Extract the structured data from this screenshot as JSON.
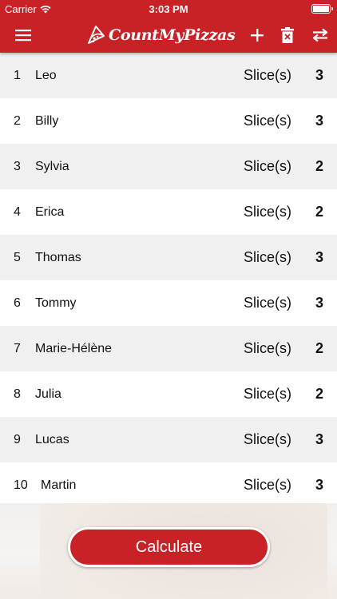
{
  "status_bar": {
    "carrier": "Carrier",
    "time": "3:03 PM"
  },
  "nav_bar": {
    "logo_text": "CountMyPizzas",
    "icons": [
      "menu-icon",
      "pizza-slice-icon",
      "add-icon",
      "delete-icon",
      "swap-icon"
    ]
  },
  "list": {
    "rows": [
      {
        "index": "1",
        "name": "Leo",
        "unit": "Slice(s)",
        "count": "3"
      },
      {
        "index": "2",
        "name": "Billy",
        "unit": "Slice(s)",
        "count": "3"
      },
      {
        "index": "3",
        "name": "Sylvia",
        "unit": "Slice(s)",
        "count": "2"
      },
      {
        "index": "4",
        "name": "Erica",
        "unit": "Slice(s)",
        "count": "2"
      },
      {
        "index": "5",
        "name": "Thomas",
        "unit": "Slice(s)",
        "count": "3"
      },
      {
        "index": "6",
        "name": "Tommy",
        "unit": "Slice(s)",
        "count": "3"
      },
      {
        "index": "7",
        "name": "Marie-Hélène",
        "unit": "Slice(s)",
        "count": "2"
      },
      {
        "index": "8",
        "name": "Julia",
        "unit": "Slice(s)",
        "count": "2"
      },
      {
        "index": "9",
        "name": "Lucas",
        "unit": "Slice(s)",
        "count": "3"
      },
      {
        "index": "10",
        "name": "Martin",
        "unit": "Slice(s)",
        "count": "3"
      }
    ]
  },
  "calculate_button": {
    "label": "Calculate"
  },
  "colors": {
    "accent": "#c82226",
    "row_alt": "#f0f0f0",
    "row": "#ffffff"
  }
}
